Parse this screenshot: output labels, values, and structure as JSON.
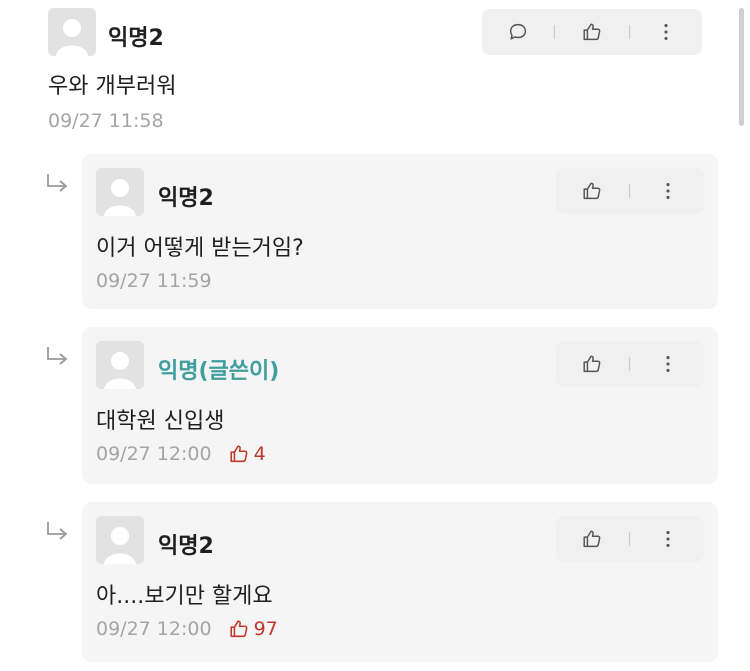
{
  "comment": {
    "author": "익명2",
    "text": "우와 개부러워",
    "time": "09/27 11:58"
  },
  "replies": [
    {
      "author": "익명2",
      "text": "이거 어떻게 받는거임?",
      "time": "09/27 11:59",
      "likes": ""
    },
    {
      "author": "익명(글쓴이)",
      "text": "대학원 신입생",
      "time": "09/27 12:00",
      "likes": "4"
    },
    {
      "author": "익명2",
      "text": "아....보기만 할게요",
      "time": "09/27 12:00",
      "likes": "97"
    }
  ],
  "icons": {
    "comment": "speech-bubble-icon",
    "like": "thumbs-up-icon",
    "more": "more-vertical-icon",
    "reply": "reply-arrow-icon",
    "avatar": "default-avatar-icon"
  },
  "colors": {
    "op_author": "#3f9e9e",
    "likes": "#c0392b",
    "meta": "#a4a4a4",
    "card_bg": "#f5f5f5"
  }
}
